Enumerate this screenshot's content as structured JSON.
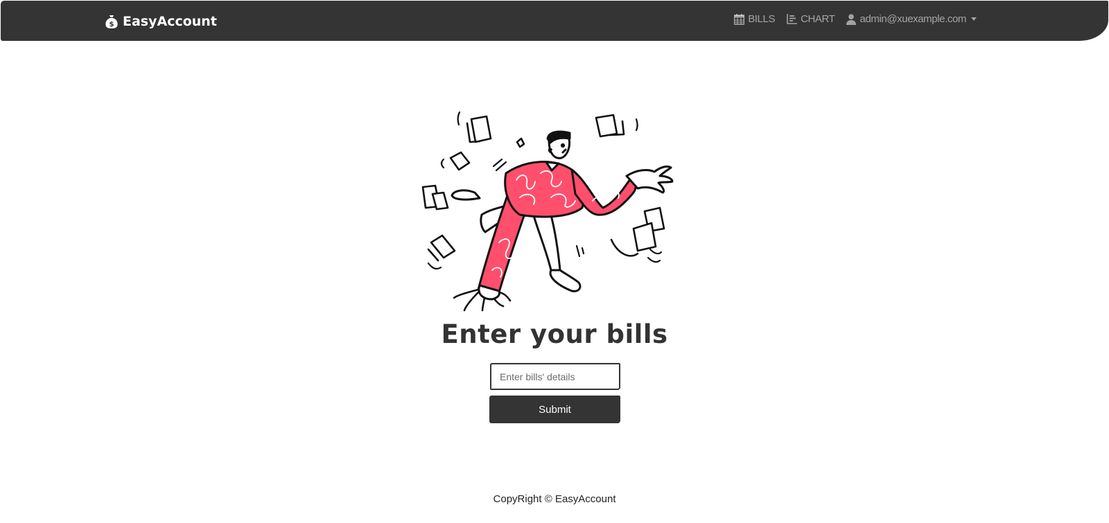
{
  "brand": {
    "name": "EasyAccount",
    "icon": "money-bag-icon"
  },
  "nav": {
    "bills": {
      "label": "BILLS",
      "icon": "calendar-icon"
    },
    "chart": {
      "label": "CHART",
      "icon": "bar-chart-icon"
    },
    "user": {
      "label": "admin@xuexample.com",
      "icon": "user-icon"
    }
  },
  "main": {
    "title": "Enter your bills",
    "input": {
      "placeholder": "Enter bills' details",
      "value": ""
    },
    "submit_label": "Submit"
  },
  "footer": {
    "text": "CopyRight © EasyAccount"
  },
  "colors": {
    "navbar": "#343434",
    "accent": "#ff4f6d",
    "button": "#343434"
  }
}
